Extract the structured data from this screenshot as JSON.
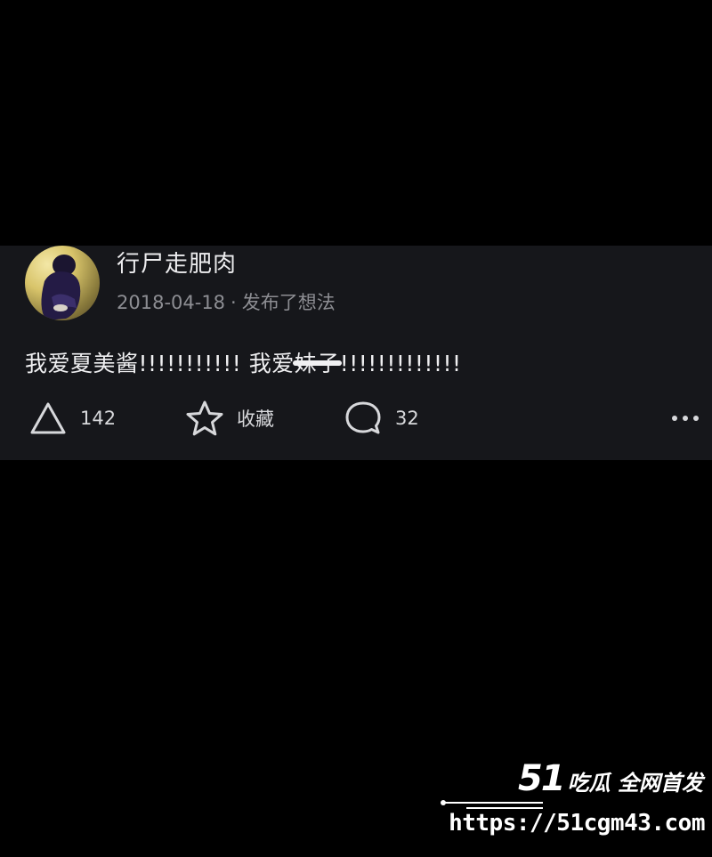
{
  "post": {
    "username": "行尸走肥肉",
    "date": "2018-04-18",
    "separator": "·",
    "action_text": "发布了想法",
    "content_part1": "我爱夏美酱!!!!!!!!!!!  我爱",
    "content_redacted": "妹子",
    "content_part2": "!!!!!!!!!!!!!",
    "likes": "142",
    "favorite_label": "收藏",
    "comments": "32"
  },
  "icons": {
    "like": "triangle-up-icon",
    "favorite": "star-icon",
    "comment": "speech-bubble-icon",
    "more": "more-dots-icon"
  },
  "watermark": {
    "brand_number": "51",
    "brand_text": "吃瓜 全网首发",
    "url": "https://51cgm43.com"
  },
  "colors": {
    "background": "#000000",
    "card": "#16171b",
    "text": "#f0f0f2",
    "meta": "#8d8e93"
  }
}
